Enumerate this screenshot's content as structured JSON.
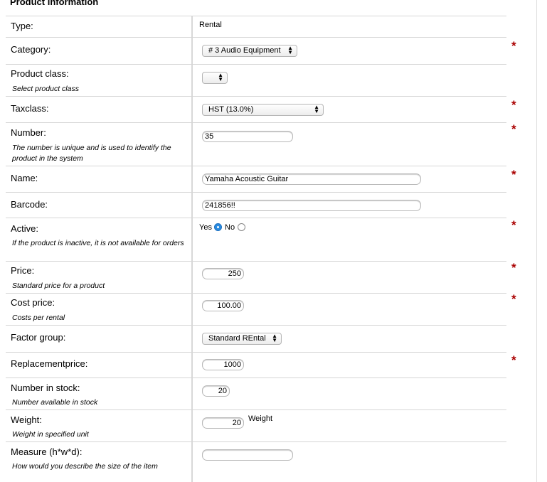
{
  "section_title": "Product information",
  "required_marker": "*",
  "fields": {
    "type": {
      "label": "Type:",
      "value": "Rental"
    },
    "category": {
      "label": "Category:",
      "selected": "# 3 Audio Equipment"
    },
    "product_class": {
      "label": "Product class:",
      "hint": "Select product class",
      "selected": ""
    },
    "taxclass": {
      "label": "Taxclass:",
      "selected": "HST (13.0%)"
    },
    "number": {
      "label": "Number:",
      "hint": "The number is unique and is used to identify the product in the system",
      "value": "35"
    },
    "name": {
      "label": "Name:",
      "value": "Yamaha Acoustic Guitar"
    },
    "barcode": {
      "label": "Barcode:",
      "value": "241856!!"
    },
    "active": {
      "label": "Active:",
      "hint": "If the product is inactive, it is not available for orders",
      "yes_label": "Yes",
      "no_label": "No",
      "selected": "Yes"
    },
    "price": {
      "label": "Price:",
      "hint": "Standard price for a product",
      "value": "250"
    },
    "cost_price": {
      "label": "Cost price:",
      "hint": "Costs per rental",
      "value": "100.00"
    },
    "factor_group": {
      "label": "Factor group:",
      "selected": "Standard REntal"
    },
    "replacement_price": {
      "label": "Replacementprice:",
      "value": "1000"
    },
    "number_in_stock": {
      "label": "Number in stock:",
      "hint": "Number available in stock",
      "value": "20"
    },
    "weight": {
      "label": "Weight:",
      "hint": "Weight in specified unit",
      "value": "20",
      "unit_label": "Weight"
    },
    "measure": {
      "label": "Measure (h*w*d):",
      "hint": "How would you describe the size of the item",
      "value": ""
    }
  },
  "colors": {
    "required": "#aa0000",
    "radio_selected": "#2a8bdf"
  }
}
